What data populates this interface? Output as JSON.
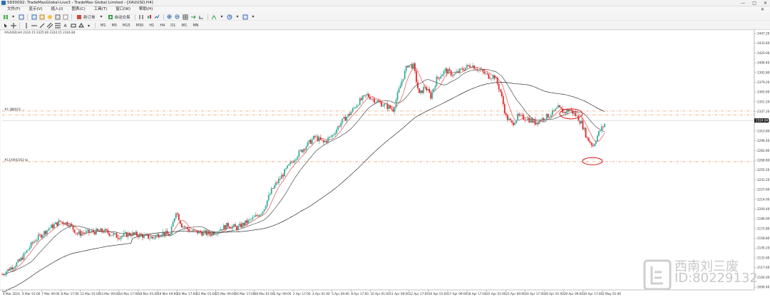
{
  "window": {
    "title": "5830092: TradeMaxGlobal-Live3 - TradeMax Global Limited - [XAUUSD,H4]",
    "min": "—",
    "max": "□",
    "close": "✕"
  },
  "menu": {
    "items": [
      "文件(F)",
      "显示(V)",
      "插入(I)",
      "图表(C)",
      "工具(T)",
      "窗口(W)",
      "帮助(H)"
    ],
    "close": "✕"
  },
  "toolbar": {
    "new_order": "新订单",
    "autotrading": "自动交易"
  },
  "timeframes": [
    "M1",
    "M5",
    "M15",
    "M30",
    "H1",
    "H4",
    "D1",
    "W1",
    "MN"
  ],
  "chart": {
    "symbol_info": "XAUUSD,H4  2324.15 2325.60 2324.15 2324.84",
    "hline1_label": "#1 [删除]号 ...",
    "hline2_label": "#11/094/263 tp",
    "current_price": "2324.84",
    "colors": {
      "bull": "#3aaa9a",
      "bear": "#e02828",
      "ma_fast": "#e03030",
      "ma_mid": "#303030",
      "ma_slow": "#101010",
      "hline": "#e8a070",
      "circle": "#e01010"
    },
    "price_axis": [
      "2447.20",
      "2433.60",
      "2420.00",
      "2406.40",
      "2392.80",
      "2379.20",
      "2365.60",
      "2351.20",
      "2337.20",
      "2324.84",
      "2310.80",
      "2296.40",
      "2282.80",
      "2268.80",
      "2255.20",
      "2241.20",
      "2227.60",
      "2214.00",
      "2200.40",
      "2186.00",
      "2172.80",
      "2158.80",
      "2145.20",
      "2131.60",
      "2117.60",
      "2104.00",
      "2090.40"
    ],
    "time_axis": [
      "4 Mar 2024",
      "6 Mar 01:00",
      "7 Mar 09:00",
      "8 Mar 17:00",
      "12 Mar 01:00",
      "13 Mar 09:00",
      "14 Mar 17:00",
      "18 Mar 01:00",
      "19 Mar 09:00",
      "20 Mar 17:00",
      "22 Mar 01:00",
      "25 Mar 09:00",
      "26 Mar 17:00",
      "28 Mar 01:00",
      "1 Apr 09:00",
      "2 Apr 17:00",
      "4 Apr 01:00",
      "5 Apr 09:00",
      "8 Apr 17:00",
      "10 Apr 01:00",
      "11 Apr 09:00",
      "12 Apr 17:00",
      "16 Apr 01:00",
      "17 Apr 09:00",
      "18 Apr 17:00",
      "22 Apr 01:00",
      "23 Apr 09:00",
      "24 Apr 17:00",
      "26 Apr 01:00",
      "29 Apr 09:00",
      "30 Apr 17:00",
      "2 May 01:00"
    ]
  },
  "watermark": {
    "line1": "西南刘三废",
    "line2": "ID:80229132"
  }
}
